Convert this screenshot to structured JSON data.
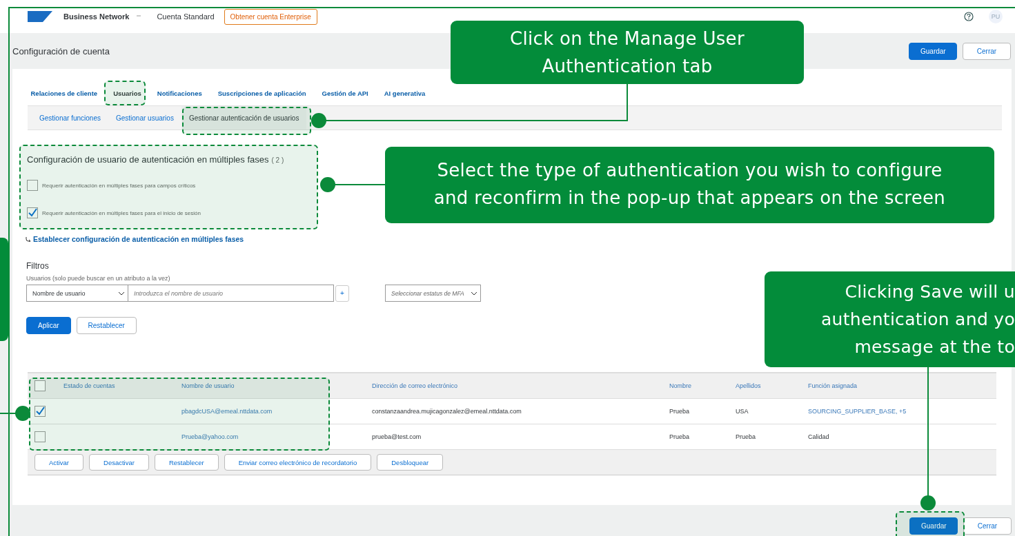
{
  "top_bar": {
    "brand": "Business Network",
    "account_type": "Cuenta Standard",
    "upgrade_button": "Obtener cuenta Enterprise",
    "avatar": "PU"
  },
  "header": {
    "title": "Configuración de cuenta",
    "buttons": [
      {
        "label": "Guardar",
        "kind": "primary"
      },
      {
        "label": "Cerrar",
        "kind": "secondary"
      }
    ]
  },
  "tabs": [
    {
      "label": "Relaciones de cliente",
      "selected": false
    },
    {
      "label": "Usuarios",
      "selected": true
    },
    {
      "label": "Notificaciones",
      "selected": false
    },
    {
      "label": "Suscripciones de aplicación",
      "selected": false
    },
    {
      "label": "Gestión de API",
      "selected": false
    },
    {
      "label": "AI generativa",
      "selected": false
    }
  ],
  "subtabs": [
    {
      "label": "Gestionar funciones",
      "selected": false
    },
    {
      "label": "Gestionar usuarios",
      "selected": false
    },
    {
      "label": "Gestionar autenticación de usuarios",
      "selected": true
    }
  ],
  "mfa": {
    "title": "Configuración de usuario de autenticación en múltiples fases",
    "count": "( 2 )",
    "options": [
      {
        "label": "Requerir autenticación en múltiples fases para campos críticos",
        "checked": false
      },
      {
        "label": "Requerir autenticación en múltiples fases para el inicio de sesión",
        "checked": true
      }
    ],
    "link": "Establecer configuración de autenticación en múltiples fases"
  },
  "filters": {
    "title": "Filtros",
    "hint": "Usuarios (solo puede buscar en un atributo a la vez)",
    "attribute": "Nombre de usuario",
    "placeholder": "Introduzca el nombre de usuario",
    "add": "+",
    "mfa_status_placeholder": "Seleccionar estatus de MFA",
    "buttons": [
      {
        "label": "Aplicar",
        "kind": "primary"
      },
      {
        "label": "Restablecer",
        "kind": "secondary"
      }
    ]
  },
  "table": {
    "select_all_checked": false,
    "columns": [
      "Estado de cuentas",
      "Nombre de usuario",
      "Dirección de correo electrónico",
      "Nombre",
      "Apellidos",
      "Función asignada"
    ],
    "rows": [
      {
        "checked": true,
        "username": "pbagdcUSA@emeal.nttdata.com",
        "email": "constanzaandrea.mujicagonzalez@emeal.nttdata.com",
        "first_name": "Prueba",
        "last_name": "USA",
        "role": "SOURCING_SUPPLIER_BASE, +5",
        "role_link": true
      },
      {
        "checked": false,
        "username": "Prueba@yahoo.com",
        "email": "prueba@test.com",
        "first_name": "Prueba",
        "last_name": "Prueba",
        "role": "Calidad",
        "role_link": false
      }
    ],
    "actions": [
      "Activar",
      "Desactivar",
      "Restablecer",
      "Enviar correo electrónico de recordatorio",
      "Desbloquear"
    ]
  },
  "footer": {
    "buttons": [
      {
        "label": "Guardar",
        "kind": "primary"
      },
      {
        "label": "Cerrar",
        "kind": "secondary"
      }
    ]
  },
  "callouts": [
    {
      "text": "Click on the Manage User\nAuthentication tab"
    },
    {
      "text": "Select the type of authentication you wish to configure\nand reconfirm in the pop-up that appears on the screen"
    },
    {
      "text": "Clicking Save will u\nauthentication and yo\nmessage at the to"
    }
  ]
}
